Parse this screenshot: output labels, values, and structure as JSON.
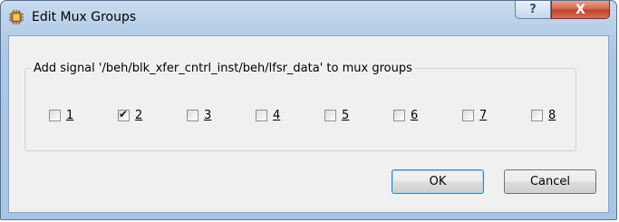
{
  "window": {
    "title": "Edit Mux Groups",
    "help_label": "?",
    "close_label": "X"
  },
  "group": {
    "legend": "Add signal '/beh/blk_xfer_cntrl_inst/beh/lfsr_data' to mux groups"
  },
  "checkboxes": [
    {
      "label": "1",
      "checked": false
    },
    {
      "label": "2",
      "checked": true
    },
    {
      "label": "3",
      "checked": false
    },
    {
      "label": "4",
      "checked": false
    },
    {
      "label": "5",
      "checked": false
    },
    {
      "label": "6",
      "checked": false
    },
    {
      "label": "7",
      "checked": false
    },
    {
      "label": "8",
      "checked": false
    }
  ],
  "buttons": {
    "ok_label": "OK",
    "cancel_label": "Cancel"
  }
}
